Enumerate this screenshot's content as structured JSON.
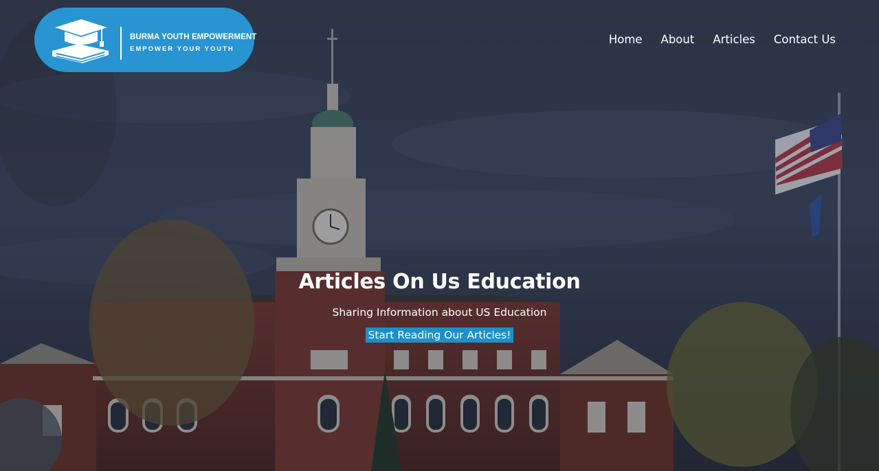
{
  "logo": {
    "name": "BURMA YOUTH EMPOWERMENT",
    "tagline": "EMPOWER YOUR YOUTH",
    "icon": "graduation-cap-book-icon",
    "color": "#2894d2"
  },
  "nav": {
    "items": [
      "Home",
      "About",
      "Articles",
      "Contact Us"
    ]
  },
  "hero": {
    "title": "Articles On Us Education",
    "subtitle": "Sharing Information about US Education",
    "cta_label": "Start Reading Our Articles!",
    "cta_color": "#1e8fc9",
    "background": "university-building-photo"
  }
}
